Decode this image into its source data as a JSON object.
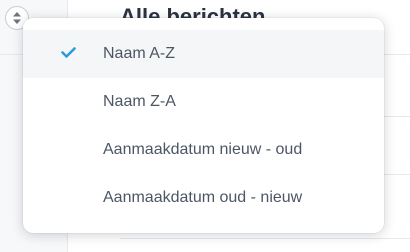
{
  "page": {
    "title": "Alle berichten"
  },
  "sort_menu": {
    "toggle_icon": "sort-updown-icon",
    "selected_icon": "check-icon",
    "accent_color": "#2d9cdb",
    "selected_index": 0,
    "options": [
      {
        "label": "Naam A-Z",
        "selected": true
      },
      {
        "label": "Naam Z-A",
        "selected": false
      },
      {
        "label": "Aanmaakdatum nieuw - oud",
        "selected": false
      },
      {
        "label": "Aanmaakdatum oud - nieuw",
        "selected": false
      }
    ]
  }
}
